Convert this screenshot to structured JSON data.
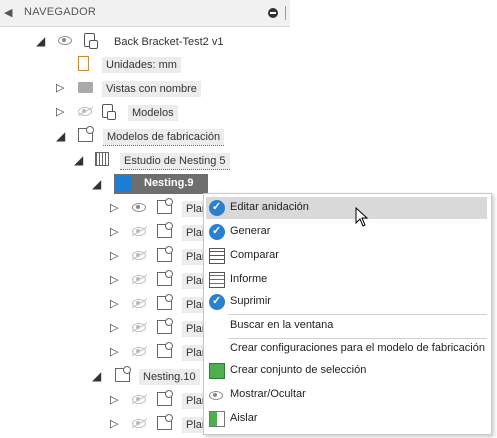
{
  "navigator": {
    "title": "NAVEGADOR"
  },
  "tree": {
    "root": "Back Bracket-Test2 v1",
    "units": "Unidades: mm",
    "named_views": "Vistas con nombre",
    "models": "Modelos",
    "manufacturing_models": "Modelos de fabricación",
    "nesting_study": "Estudio de Nesting 5",
    "nesting9": "Nesting.9",
    "plan_label": "Plan",
    "nesting10": "Nesting.10"
  },
  "context_menu": {
    "items": [
      "Editar anidación",
      "Generar",
      "Comparar",
      "Informe",
      "Suprimir",
      "Buscar en la ventana",
      "Crear configuraciones para el modelo de fabricación",
      "Crear conjunto de selección",
      "Mostrar/Ocultar",
      "Aislar"
    ]
  },
  "colors": {
    "selection_bg": "#6e6e6e",
    "accent": "#2b7fd1",
    "highlight": "#d9d9d9"
  }
}
